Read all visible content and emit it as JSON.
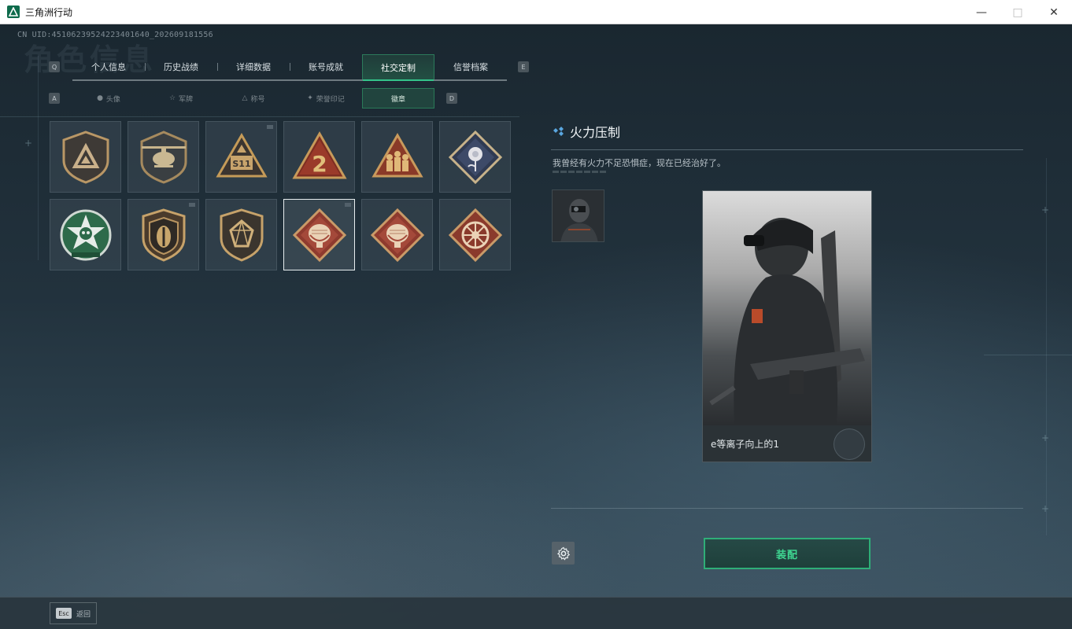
{
  "window": {
    "title": "三角洲行动",
    "controls": [
      "minimize",
      "maximize",
      "close"
    ]
  },
  "header": {
    "uid": "CN UID:451062395242234016​40_202609181556",
    "ghost_title": "角色信息"
  },
  "top_tabs": {
    "left_key": "Q",
    "right_key": "E",
    "items": [
      {
        "label": "个人信息",
        "active": false
      },
      {
        "label": "历史战绩",
        "active": false
      },
      {
        "label": "详细数据",
        "active": false
      },
      {
        "label": "账号成就",
        "active": false
      },
      {
        "label": "社交定制",
        "active": true
      },
      {
        "label": "信誉档案",
        "active": false
      }
    ]
  },
  "sub_tabs": {
    "left_key": "A",
    "right_key": "D",
    "items": [
      {
        "label": "头像",
        "icon": "person-icon",
        "active": false
      },
      {
        "label": "军牌",
        "icon": "star-icon",
        "active": false
      },
      {
        "label": "称号",
        "icon": "triangle-icon",
        "active": false
      },
      {
        "label": "荣誉印记",
        "icon": "wing-icon",
        "active": false
      },
      {
        "label": "徽章",
        "icon": "",
        "active": true
      }
    ]
  },
  "badges": [
    {
      "name": "badge-delta-shield",
      "selected": false,
      "new": false
    },
    {
      "name": "badge-helicopter",
      "selected": false,
      "new": false
    },
    {
      "name": "badge-s11-triangle",
      "selected": false,
      "new": true
    },
    {
      "name": "badge-number-2-triangle",
      "selected": false,
      "new": false
    },
    {
      "name": "badge-squad-triangle",
      "selected": false,
      "new": false
    },
    {
      "name": "badge-rose-diamond",
      "selected": false,
      "new": false
    },
    {
      "name": "badge-green-skull-star",
      "selected": false,
      "new": false
    },
    {
      "name": "badge-bronze-shield",
      "selected": false,
      "new": true
    },
    {
      "name": "badge-gem-shield",
      "selected": false,
      "new": false
    },
    {
      "name": "badge-beast-diamond",
      "selected": true,
      "new": true
    },
    {
      "name": "badge-beast-diamond-2",
      "selected": false,
      "new": false
    },
    {
      "name": "badge-wheel-diamond",
      "selected": false,
      "new": false
    }
  ],
  "detail": {
    "title": "火力压制",
    "description": "我曾经有火力不足恐惧症，现在已经治好了。",
    "operator_name": "e等离子向上的1",
    "equip_label": "装配"
  },
  "footer": {
    "esc_key": "Esc",
    "back_label": "返回"
  },
  "colors": {
    "accent_green": "#34c38a",
    "equip_text": "#3fd892",
    "badge_gold": "#c9a46a",
    "badge_red": "#8a3a2c"
  }
}
